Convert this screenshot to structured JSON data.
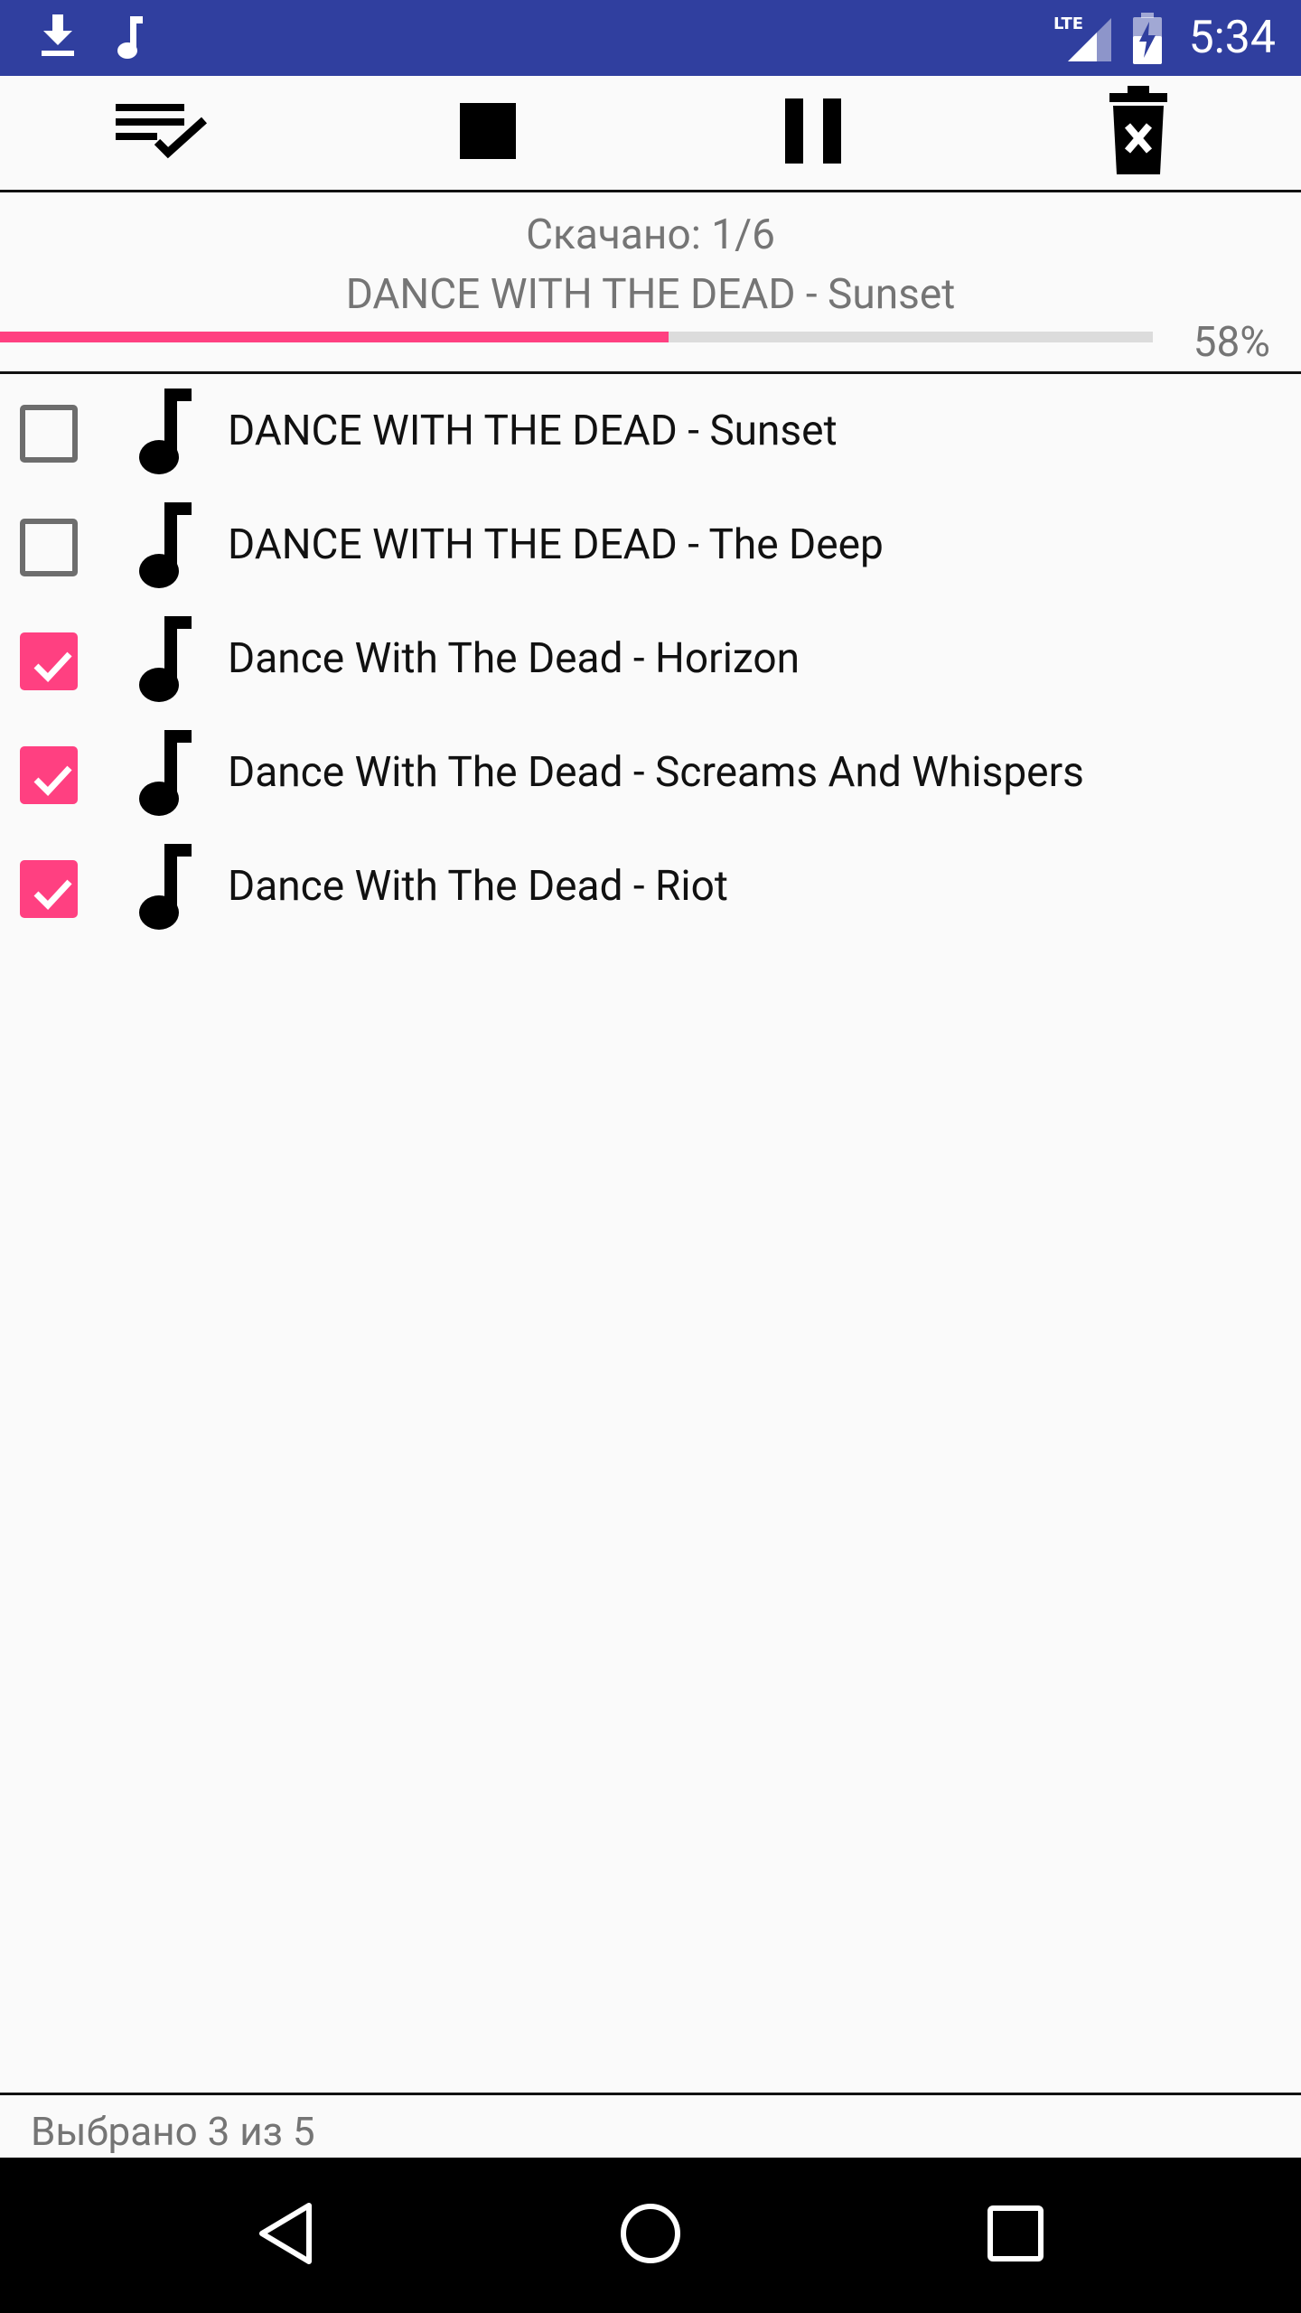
{
  "status_bar": {
    "time": "5:34",
    "network_label": "LTE",
    "icons": [
      "download-icon",
      "music-note-icon",
      "signal-icon",
      "battery-charging-icon"
    ]
  },
  "toolbar": {
    "actions": [
      {
        "name": "select-all",
        "icon": "playlist-check-icon"
      },
      {
        "name": "stop",
        "icon": "stop-icon"
      },
      {
        "name": "pause",
        "icon": "pause-icon"
      },
      {
        "name": "delete",
        "icon": "delete-x-icon"
      }
    ]
  },
  "progress": {
    "count_text": "Скачано: 1/6",
    "current_track": "DANCE WITH THE DEAD - Sunset",
    "percent": 58,
    "percent_text": "58%"
  },
  "tracks": [
    {
      "title": "DANCE WITH THE DEAD - Sunset",
      "checked": false
    },
    {
      "title": "DANCE WITH THE DEAD - The Deep",
      "checked": false
    },
    {
      "title": "Dance With The Dead - Horizon",
      "checked": true
    },
    {
      "title": "Dance With The Dead - Screams And Whispers",
      "checked": true
    },
    {
      "title": "Dance With The Dead - Riot",
      "checked": true
    }
  ],
  "footer": {
    "selected_text": "Выбрано 3 из 5"
  },
  "colors": {
    "status_bar": "#303f9f",
    "accent": "#ff4081",
    "progress_track": "#dcdcdc",
    "secondary_text": "#757575"
  },
  "nav_bar": {
    "buttons": [
      "back-icon",
      "home-icon",
      "recents-icon"
    ]
  }
}
